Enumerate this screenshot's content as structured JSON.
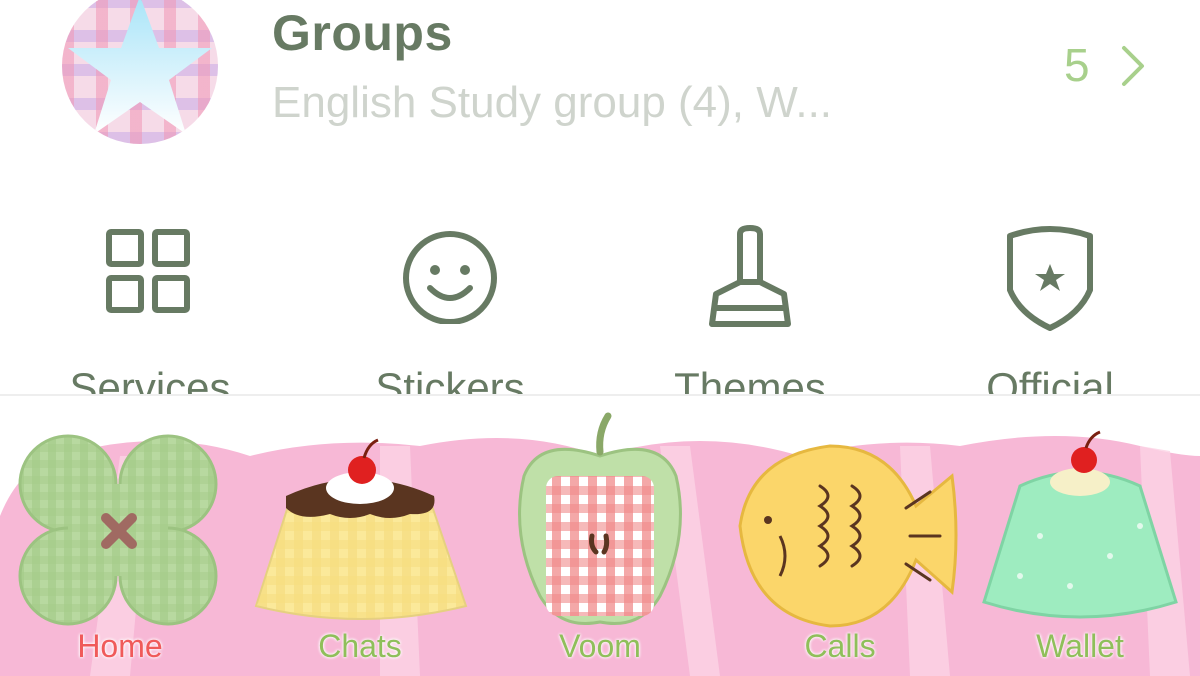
{
  "groups": {
    "title": "Groups",
    "subtitle": "English Study group (4), W...",
    "count": "5",
    "icon": "star-icon",
    "chevron_icon": "chevron-right-icon"
  },
  "shortcuts": [
    {
      "label": "Services",
      "icon": "grid-icon"
    },
    {
      "label": "Stickers",
      "icon": "smiley-icon"
    },
    {
      "label": "Themes",
      "icon": "paint-brush-icon"
    },
    {
      "label": "Official",
      "icon": "shield-star-icon"
    }
  ],
  "tabs": [
    {
      "label": "Home",
      "icon": "clover-icon",
      "color": "#f05a5a",
      "active": true
    },
    {
      "label": "Chats",
      "icon": "pudding-icon",
      "color": "#8fbf5a",
      "active": false
    },
    {
      "label": "Voom",
      "icon": "apple-icon",
      "color": "#8fbf5a",
      "active": false
    },
    {
      "label": "Calls",
      "icon": "taiyaki-fish-icon",
      "color": "#8fbf5a",
      "active": false
    },
    {
      "label": "Wallet",
      "icon": "jelly-icon",
      "color": "#8fbf5a",
      "active": false
    }
  ],
  "colors": {
    "accent_text": "#677a63",
    "count_green": "#a8d08c",
    "tab_background_pink": "#f7b8d6"
  }
}
